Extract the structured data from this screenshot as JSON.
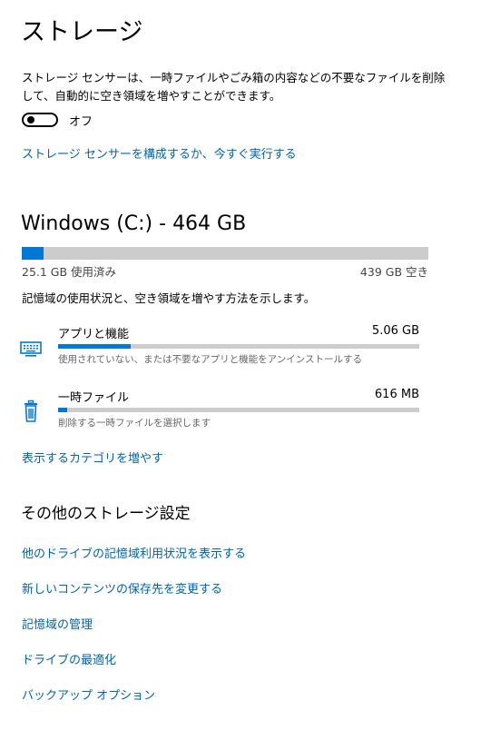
{
  "storage": {
    "title": "ストレージ",
    "description": "ストレージ センサーは、一時ファイルやごみ箱の内容などの不要なファイルを削除して、自動的に空き領域を増やすことができます。",
    "sense_toggle_label": "オフ",
    "sense_toggle_on": false,
    "configure_link": "ストレージ センサーを構成するか、今すぐ実行する"
  },
  "drive": {
    "title": "Windows (C:) - 464 GB",
    "used_label": "25.1 GB 使用済み",
    "free_label": "439 GB 空き",
    "used_fraction": 0.054,
    "usage_description": "記憶域の使用状況と、空き領域を増やす方法を示します。",
    "categories": [
      {
        "name": "アプリと機能",
        "size": "5.06 GB",
        "description": "使用されていない、または不要なアプリと機能をアンインストールする",
        "fraction": 0.2,
        "icon": "keyboard-icon"
      },
      {
        "name": "一時ファイル",
        "size": "616 MB",
        "description": "削除する一時ファイルを選択します",
        "fraction": 0.025,
        "icon": "trash-icon"
      }
    ],
    "show_more_link": "表示するカテゴリを増やす"
  },
  "other_settings": {
    "title": "その他のストレージ設定",
    "links": [
      "他のドライブの記憶域利用状況を表示する",
      "新しいコンテンツの保存先を変更する",
      "記憶域の管理",
      "ドライブの最適化",
      "バックアップ オプション"
    ]
  },
  "colors": {
    "accent": "#0078d7",
    "link": "#0063b1",
    "bar_track": "#cccccc"
  }
}
